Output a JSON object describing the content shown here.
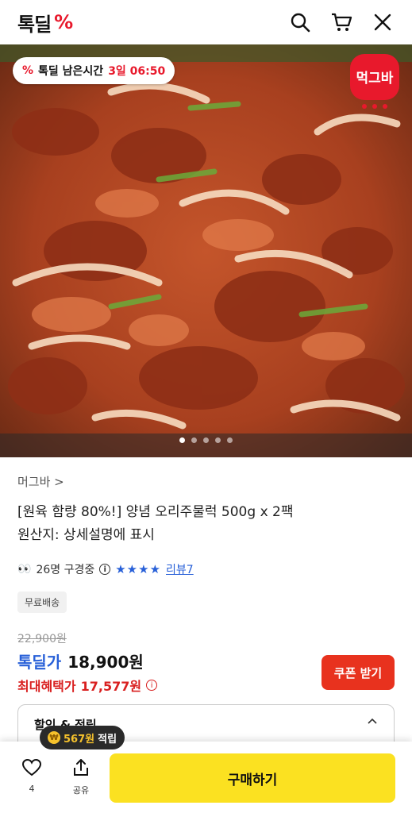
{
  "header": {
    "logo_text": "톡딜",
    "logo_mark": "%",
    "icons": [
      "search-icon",
      "cart-icon",
      "close-icon"
    ]
  },
  "hero": {
    "timer_icon": "%",
    "timer_label": "톡딜 남은시간",
    "timer_value": "3일 06:50",
    "brand_badge": "먹그바",
    "slide_count": 5,
    "active_slide": 1
  },
  "product": {
    "seller": "머그바 >",
    "title_line1": "[원육 함량 80%!] 양념 오리주물럭 500g x 2팩",
    "title_line2": "원산지: 상세설명에 표시",
    "viewers_icon": "eyes-icon",
    "viewers_text": "26명 구경중",
    "stars": "★★★★",
    "review_link": "리뷰7",
    "shipping_badge": "무료배송",
    "original_price": "22,900원",
    "deal_label": "톡딜가",
    "deal_price": "18,900원",
    "max_benefit_label": "최대혜택가",
    "max_benefit_price": "17,577원",
    "coupon_button": "쿠폰 받기",
    "discount_section": "할인 & 적립"
  },
  "bottom_bar": {
    "like_count": "4",
    "share_label": "공유",
    "buy_button": "구매하기",
    "points_amount": "567원",
    "points_label": "적립"
  },
  "colors": {
    "accent_red": "#e8192c",
    "deal_blue": "#2860d8",
    "buy_yellow": "#fbe121"
  }
}
